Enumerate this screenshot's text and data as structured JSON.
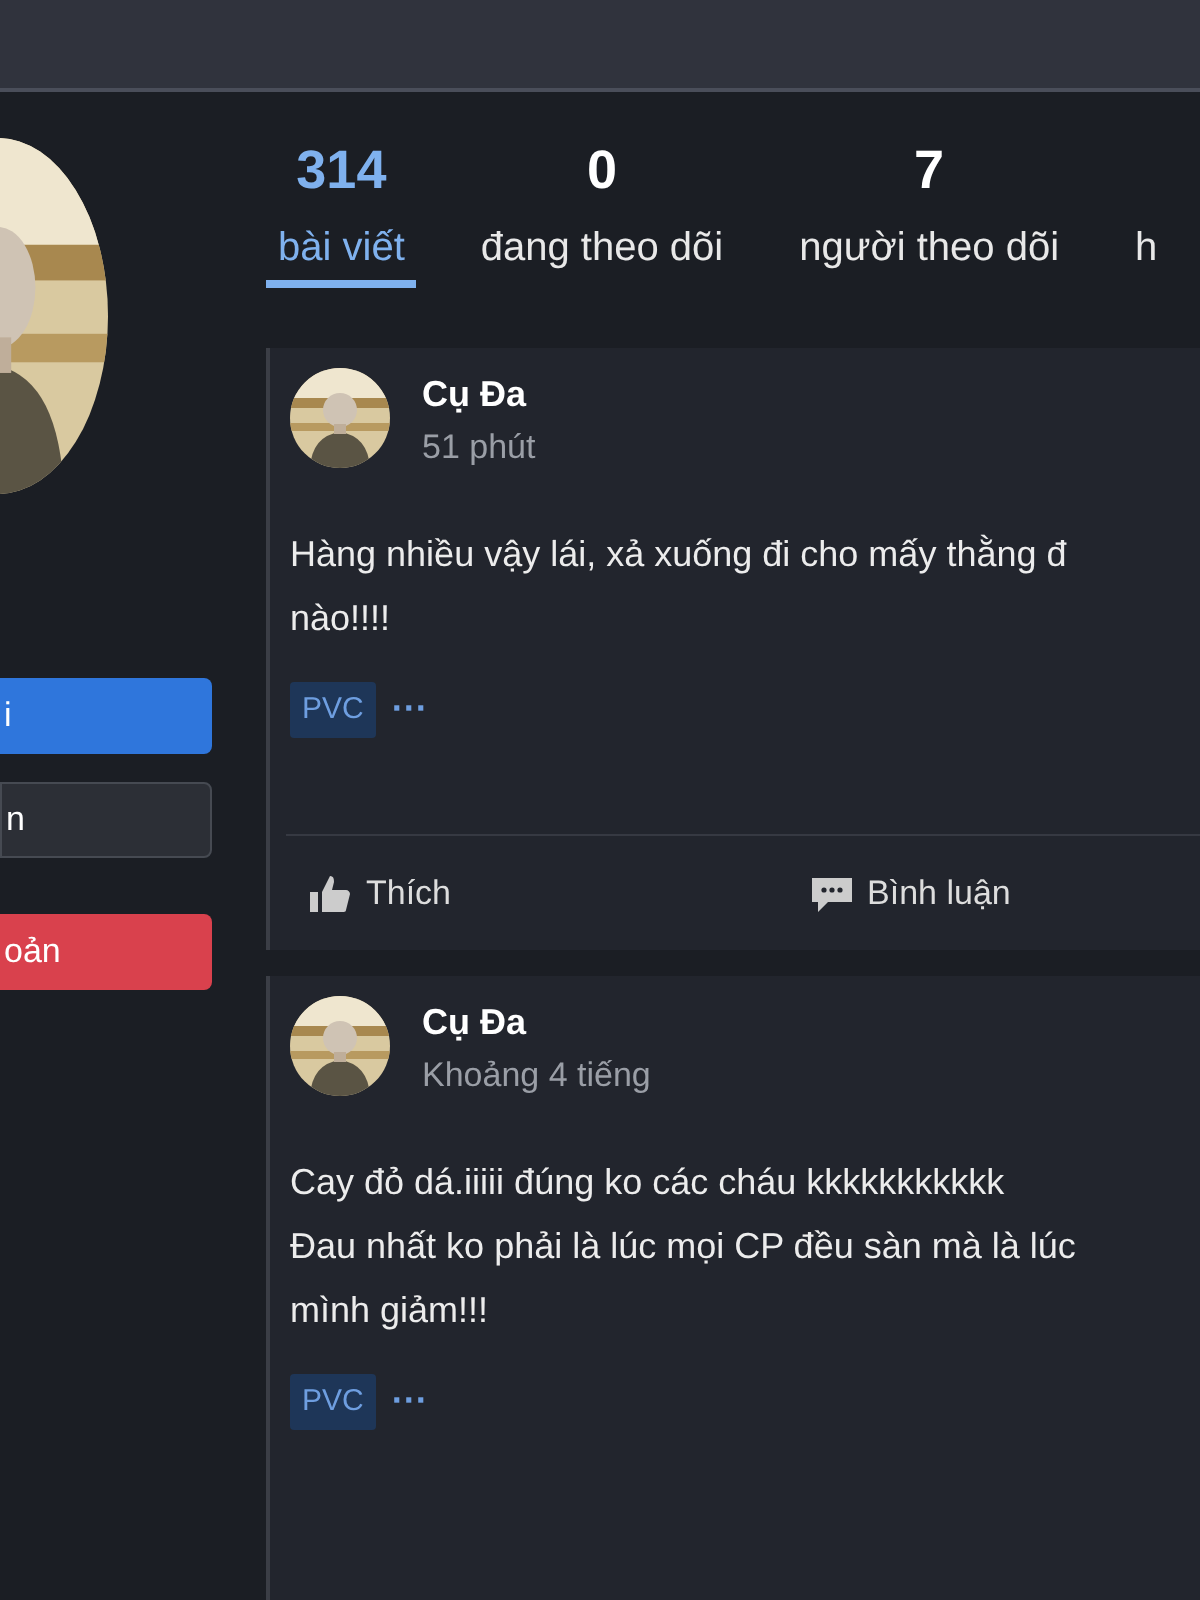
{
  "profile": {
    "buttons": [
      {
        "label": "i",
        "kind": "primary"
      },
      {
        "label": "n",
        "kind": "secondary"
      },
      {
        "label": "oản",
        "kind": "danger"
      }
    ]
  },
  "stats": [
    {
      "count": "314",
      "label": "bài viết",
      "selected": true
    },
    {
      "count": "0",
      "label": "đang theo dõi",
      "selected": false
    },
    {
      "count": "7",
      "label": "người theo dõi",
      "selected": false
    },
    {
      "label": "h",
      "selected": false
    }
  ],
  "posts": [
    {
      "author": "Cụ Đa",
      "time": "51 phút",
      "lines": [
        "Hàng nhiều vậy lái, xả xuống đi cho mấy thằng đ",
        "nào!!!!"
      ],
      "tag": "PVC",
      "more": "···",
      "actions": [
        "Thích",
        "Bình luận"
      ]
    },
    {
      "author": "Cụ Đa",
      "time": "Khoảng 4 tiếng",
      "lines": [
        "Cay đỏ dá.iiiii đúng ko các cháu kkkkkkkkkkk",
        "Đau nhất ko phải là lúc mọi CP đều sàn mà là lúc",
        "mình giảm!!!"
      ],
      "tag": "PVC",
      "more": "···"
    }
  ]
}
